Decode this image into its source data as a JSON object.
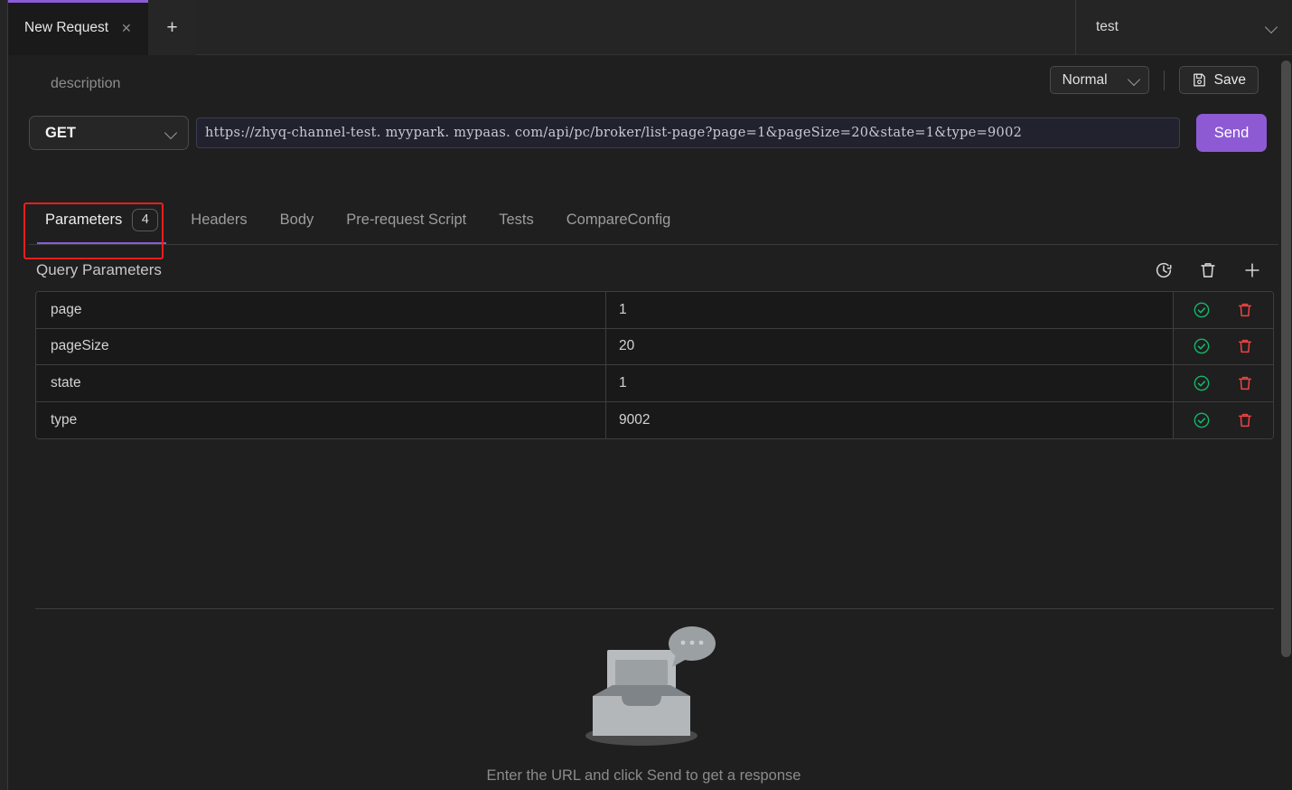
{
  "window": {
    "tabs": [
      {
        "title": "New Request",
        "close_icon": "close-icon"
      }
    ],
    "new_tab_icon": "plus-icon",
    "environment": {
      "value": "test",
      "chevron_icon": "chevron-down-icon"
    }
  },
  "request": {
    "description_placeholder": "description",
    "mode": {
      "value": "Normal",
      "chevron_icon": "chevron-down-icon"
    },
    "save": {
      "label": "Save",
      "icon": "floppy-disk-icon"
    },
    "method": {
      "value": "GET",
      "chevron_icon": "chevron-down-icon"
    },
    "url": "https://zhyq-channel-test. myypark. mypaas. com/api/pc/broker/list-page?page=1&pageSize=20&state=1&type=9002",
    "send": {
      "label": "Send"
    },
    "accent_color": "#8d5ad4",
    "highlight_color": "#ef1d1d"
  },
  "section_tabs": [
    {
      "label": "Parameters",
      "badge": "4",
      "active": true
    },
    {
      "label": "Headers",
      "badge": "",
      "active": false
    },
    {
      "label": "Body",
      "badge": "",
      "active": false
    },
    {
      "label": "Pre-request Script",
      "badge": "",
      "active": false
    },
    {
      "label": "Tests",
      "badge": "",
      "active": false
    },
    {
      "label": "CompareConfig",
      "badge": "",
      "active": false
    }
  ],
  "query_parameters": {
    "title": "Query Parameters",
    "toolbar": [
      {
        "icon": "history-reset-icon"
      },
      {
        "icon": "trash-icon"
      },
      {
        "icon": "plus-icon"
      }
    ],
    "row_actions": {
      "confirm_icon": "check-circle-icon",
      "confirm_color": "#17b56a",
      "delete_icon": "trash-icon",
      "delete_color": "#f04343"
    },
    "rows": [
      {
        "key": "page",
        "value": "1"
      },
      {
        "key": "pageSize",
        "value": "20"
      },
      {
        "key": "state",
        "value": "1"
      },
      {
        "key": "type",
        "value": "9002"
      }
    ]
  },
  "response": {
    "empty_message": "Enter the URL and click Send to get a response",
    "illustration": "inbox-tray-icon"
  }
}
